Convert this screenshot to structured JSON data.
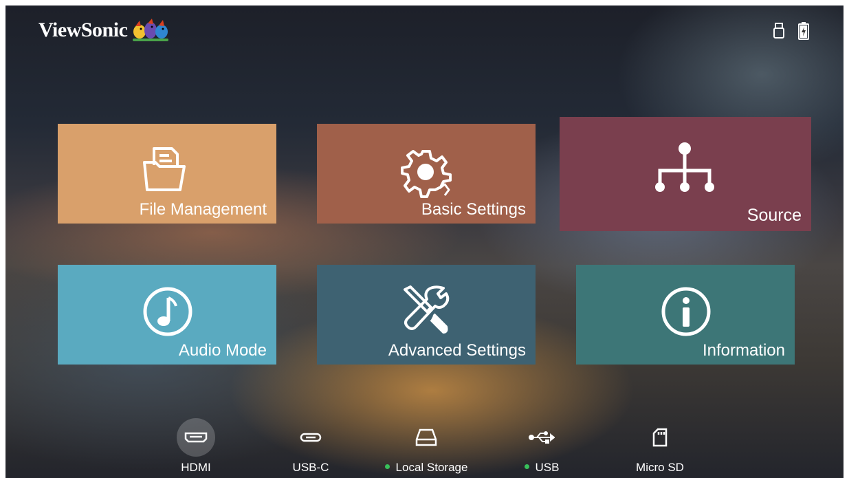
{
  "brand": {
    "name": "ViewSonic"
  },
  "status_icons": [
    "usb-drive-icon",
    "battery-charging-icon"
  ],
  "tiles": [
    {
      "label": "File Management",
      "icon": "folder-documents-icon",
      "color": "#d9a06b"
    },
    {
      "label": "Basic Settings",
      "icon": "gear-icon",
      "color": "#a0604a"
    },
    {
      "label": "Source",
      "icon": "source-tree-icon",
      "color": "#7a3f4e"
    },
    {
      "label": "Audio Mode",
      "icon": "music-note-icon",
      "color": "#5aaac0"
    },
    {
      "label": "Advanced Settings",
      "icon": "wrench-screwdriver-icon",
      "color": "#3e6272"
    },
    {
      "label": "Information",
      "icon": "info-icon",
      "color": "#3d7677"
    }
  ],
  "sources": [
    {
      "label": "HDMI",
      "icon": "hdmi-icon",
      "selected": true,
      "connected": false
    },
    {
      "label": "USB-C",
      "icon": "usb-c-icon",
      "selected": false,
      "connected": false
    },
    {
      "label": "Local Storage",
      "icon": "hard-drive-icon",
      "selected": false,
      "connected": true
    },
    {
      "label": "USB",
      "icon": "usb-icon",
      "selected": false,
      "connected": true
    },
    {
      "label": "Micro SD",
      "icon": "sd-card-icon",
      "selected": false,
      "connected": false
    }
  ]
}
